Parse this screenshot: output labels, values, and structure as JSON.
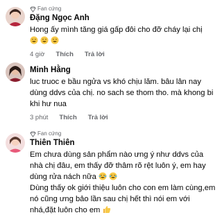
{
  "comments": [
    {
      "badge": "Fan cứng",
      "author": "Đặng Ngọc Anh",
      "text": "Hong ấy mình tăng giá gấp đôi cho đỡ cháy lại chị",
      "time": "4 giờ",
      "like": "Thích",
      "reply": "Trả lời"
    },
    {
      "author": "Minh Hằng",
      "text": "luc truoc e bầu ngửa vs khó chịu lăm. bâu lân nay dùng ddvs của chị. no sach se thom tho. mà khong bi khi hư nua",
      "time": "3 phút",
      "like": "Thích",
      "reply": "Trả lời"
    },
    {
      "badge": "Fan cứng",
      "author": "Thiên Thiên",
      "text1": "Em chưa dùng sản phẩm nào ưng ý như ddvs của nhà chị đâu, em thấy đỡ thâm rõ rệt luôn ý, em hay dùng rửa nách nữa",
      "text2": "Dùng thấy ok giới thiệu luôn cho con em làm cùng,em nó cũng ưng bảo lần sau chị hết thì nói em với nhá,đặt luôn cho em",
      "time": "4 giờ",
      "like": "Thích",
      "reply": "Trả lời"
    }
  ],
  "colors": {
    "meta": "#65676b",
    "text": "#050505",
    "badge_gem": "#8a8d91"
  }
}
